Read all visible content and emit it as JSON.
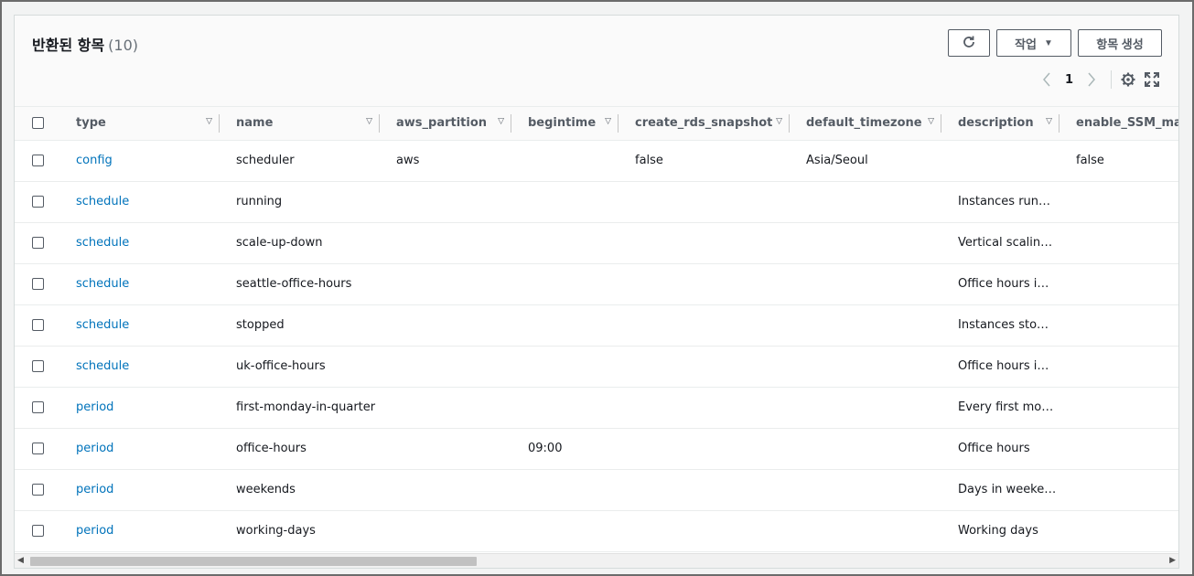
{
  "panel": {
    "title": "반환된 항목",
    "count": "(10)"
  },
  "toolbar": {
    "refresh_icon": "refresh-icon",
    "actions_label": "작업",
    "create_label": "항목 생성"
  },
  "pagination": {
    "current_page": "1"
  },
  "table": {
    "columns": [
      "type",
      "name",
      "aws_partition",
      "begintime",
      "create_rds_snapshot",
      "default_timezone",
      "description",
      "enable_SSM_maint"
    ],
    "rows": [
      {
        "type": "config",
        "name": "scheduler",
        "aws_partition": "aws",
        "begintime": "",
        "create_rds_snapshot": "false",
        "default_timezone": "Asia/Seoul",
        "description": "",
        "enable_SSM_maint": "false"
      },
      {
        "type": "schedule",
        "name": "running",
        "aws_partition": "",
        "begintime": "",
        "create_rds_snapshot": "",
        "default_timezone": "",
        "description": "Instances run…",
        "enable_SSM_maint": ""
      },
      {
        "type": "schedule",
        "name": "scale-up-down",
        "aws_partition": "",
        "begintime": "",
        "create_rds_snapshot": "",
        "default_timezone": "",
        "description": "Vertical scalin…",
        "enable_SSM_maint": ""
      },
      {
        "type": "schedule",
        "name": "seattle-office-hours",
        "aws_partition": "",
        "begintime": "",
        "create_rds_snapshot": "",
        "default_timezone": "",
        "description": "Office hours i…",
        "enable_SSM_maint": ""
      },
      {
        "type": "schedule",
        "name": "stopped",
        "aws_partition": "",
        "begintime": "",
        "create_rds_snapshot": "",
        "default_timezone": "",
        "description": "Instances sto…",
        "enable_SSM_maint": ""
      },
      {
        "type": "schedule",
        "name": "uk-office-hours",
        "aws_partition": "",
        "begintime": "",
        "create_rds_snapshot": "",
        "default_timezone": "",
        "description": "Office hours i…",
        "enable_SSM_maint": ""
      },
      {
        "type": "period",
        "name": "first-monday-in-quarter",
        "aws_partition": "",
        "begintime": "",
        "create_rds_snapshot": "",
        "default_timezone": "",
        "description": "Every first mo…",
        "enable_SSM_maint": ""
      },
      {
        "type": "period",
        "name": "office-hours",
        "aws_partition": "",
        "begintime": "09:00",
        "create_rds_snapshot": "",
        "default_timezone": "",
        "description": "Office hours",
        "enable_SSM_maint": ""
      },
      {
        "type": "period",
        "name": "weekends",
        "aws_partition": "",
        "begintime": "",
        "create_rds_snapshot": "",
        "default_timezone": "",
        "description": "Days in weeke…",
        "enable_SSM_maint": ""
      },
      {
        "type": "period",
        "name": "working-days",
        "aws_partition": "",
        "begintime": "",
        "create_rds_snapshot": "",
        "default_timezone": "",
        "description": "Working days",
        "enable_SSM_maint": ""
      }
    ]
  },
  "colors": {
    "link": "#0073bb",
    "border": "#eaeded",
    "header_bg": "#fafafa"
  }
}
